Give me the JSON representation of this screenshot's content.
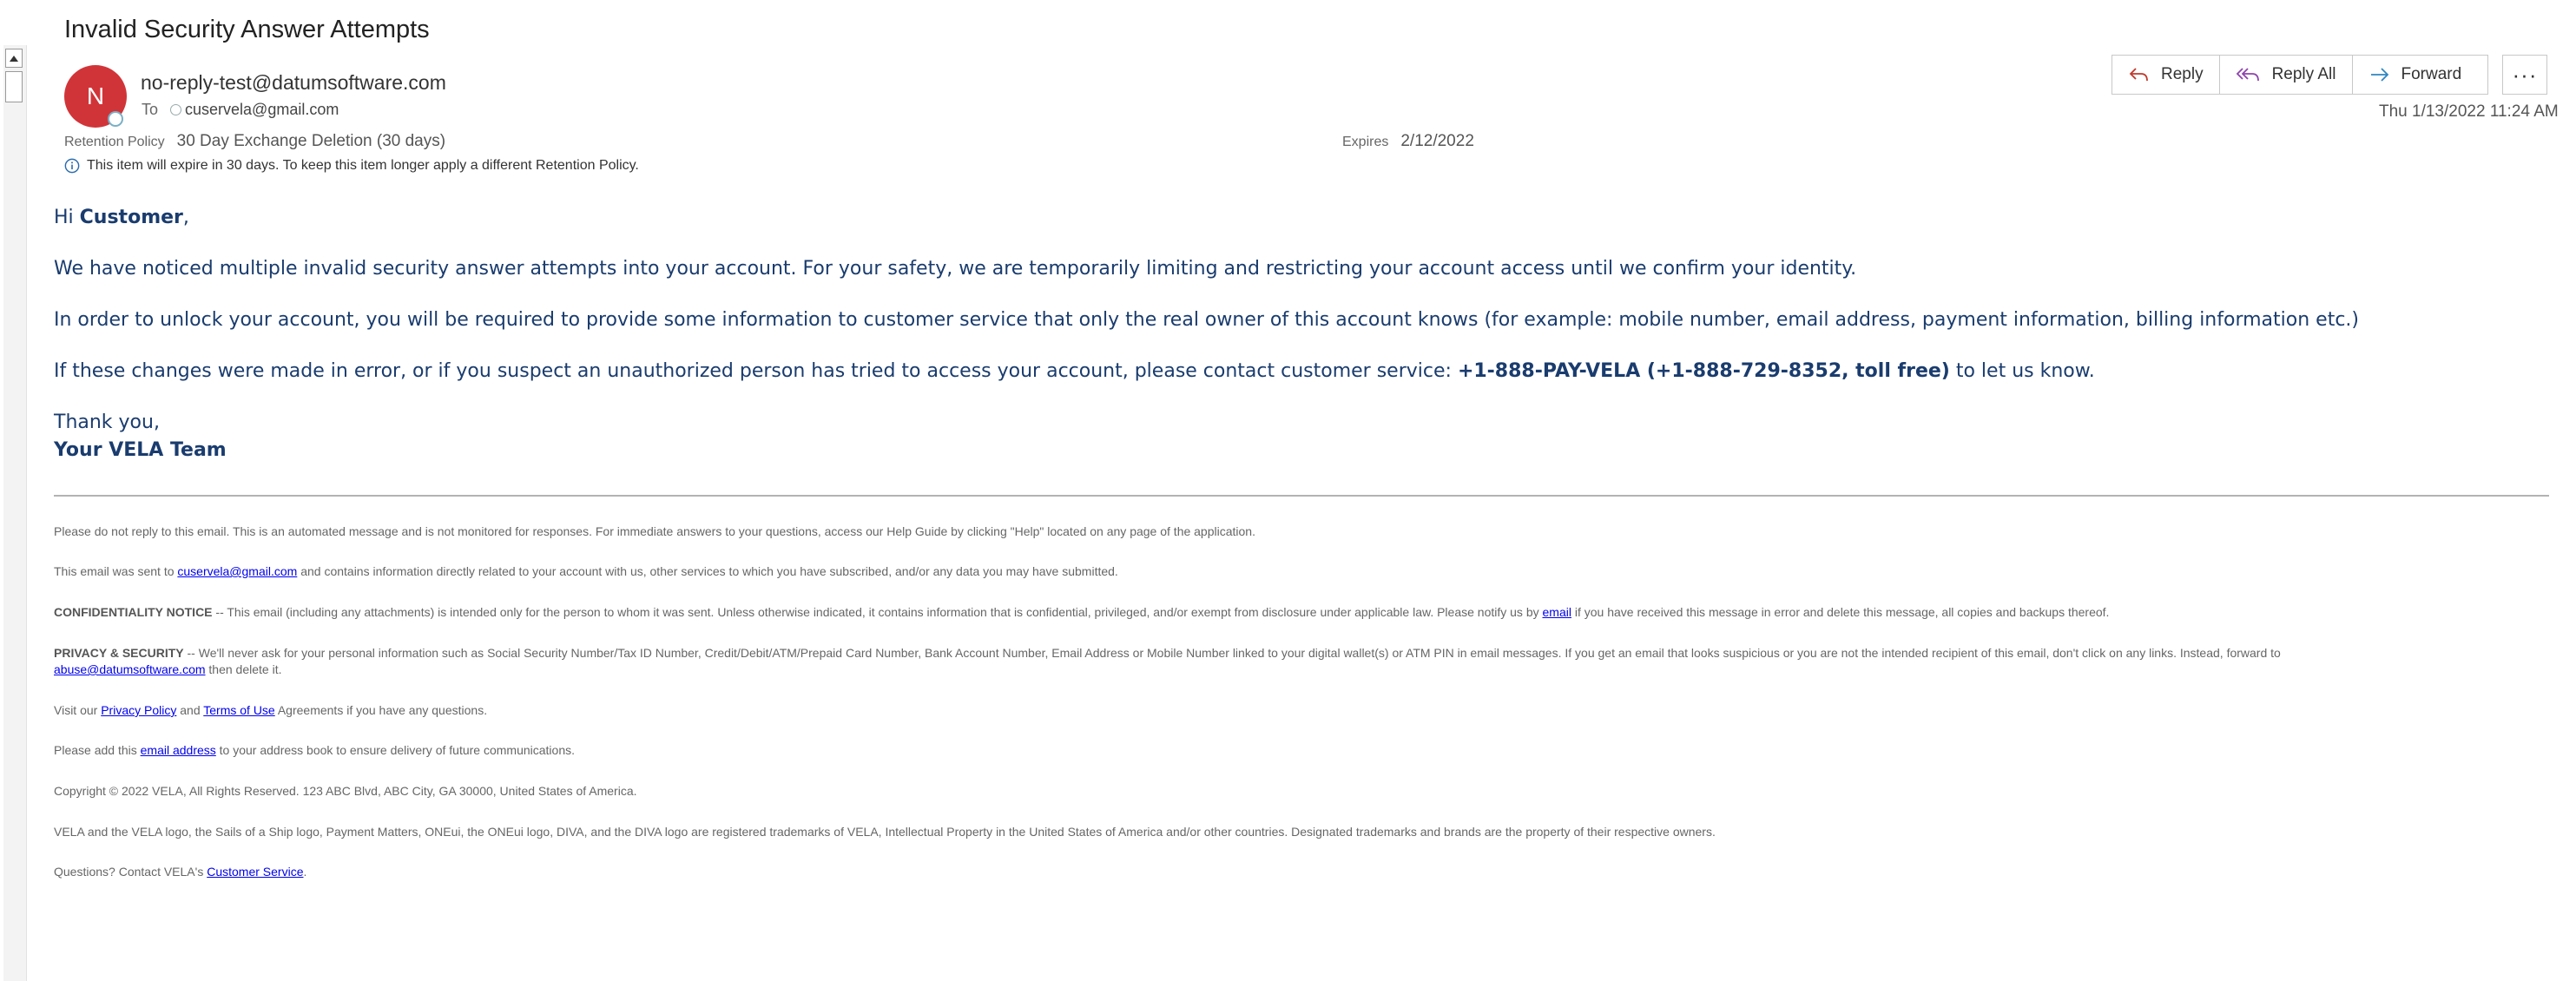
{
  "message": {
    "subject": "Invalid Security Answer Attempts",
    "avatar_initial": "N",
    "sender": "no-reply-test@datumsoftware.com",
    "to_label": "To",
    "recipient": "cuservela@gmail.com",
    "retention_label": "Retention Policy",
    "retention_value": "30 Day Exchange Deletion (30 days)",
    "expires_label": "Expires",
    "expires_value": "2/12/2022",
    "info_text": "This item will expire in 30 days. To keep this item longer apply a different Retention Policy.",
    "date": "Thu 1/13/2022 11:24 AM"
  },
  "toolbar": {
    "reply": "Reply",
    "reply_all": "Reply All",
    "forward": "Forward",
    "more": "···"
  },
  "body": {
    "greeting_hi": "Hi ",
    "greeting_name": "Customer",
    "greeting_comma": ",",
    "p1": "We have noticed multiple invalid security answer attempts into your account. For your safety, we are temporarily limiting and restricting your account access until we confirm your identity.",
    "p2": "In order to unlock your account, you will be required to provide some information to customer service that only the real owner of this account knows (for example: mobile number, email address, payment information, billing information etc.)",
    "p3_pre": "If these changes were made in error, or if you suspect an unauthorized person has tried to access your account, please contact customer service: ",
    "p3_phone": "+1-888-PAY-VELA (+1-888-729-8352, toll free)",
    "p3_post": " to let us know.",
    "thanks": "Thank you,",
    "team": "Your VELA Team"
  },
  "footer": {
    "f1": "Please do not reply to this email. This is an automated message and is not monitored for responses. For immediate answers to your questions, access our Help Guide by clicking \"Help\" located on any page of the application.",
    "f2_pre": "This email was sent to ",
    "f2_link": "cuservela@gmail.com",
    "f2_post": " and contains information directly related to your account with us, other services to which you have subscribed, and/or any data you may have submitted.",
    "f3_bold": "CONFIDENTIALITY NOTICE",
    "f3_pre": " -- This email (including any attachments) is intended only for the person to whom it was sent. Unless otherwise indicated, it contains information that is confidential, privileged, and/or exempt from disclosure under applicable law. Please notify us by ",
    "f3_link": "email",
    "f3_post": " if you have received this message in error and delete this message, all copies and backups thereof.",
    "f4_bold": "PRIVACY & SECURITY",
    "f4_pre": " -- We'll never ask for your personal information such as Social Security Number/Tax ID Number, Credit/Debit/ATM/Prepaid Card Number, Bank Account Number, Email Address or Mobile Number linked to your digital wallet(s) or ATM PIN in email messages. If you get an email that looks suspicious or you are not the intended recipient of this email, don't click on any links. Instead, forward to",
    "f4_link": "abuse@datumsoftware.com",
    "f4_post": " then delete it.",
    "f5_pre": "Visit our ",
    "f5_link1": "Privacy Policy",
    "f5_mid": " and ",
    "f5_link2": "Terms of Use",
    "f5_post": " Agreements if you have any questions.",
    "f6_pre": "Please add this ",
    "f6_link": "email address",
    "f6_post": " to your address book to ensure delivery of future communications.",
    "f7": "Copyright © 2022 VELA, All Rights Reserved. 123 ABC Blvd, ABC City, GA 30000, United States of America.",
    "f8": "VELA and the VELA logo, the Sails of a Ship logo, Payment Matters, ONEui, the ONEui logo, DIVA, and the DIVA logo are registered trademarks of VELA, Intellectual Property in the United States of America and/or other countries. Designated trademarks and brands are the property of their respective owners.",
    "f9_pre": "Questions? Contact VELA's ",
    "f9_link": "Customer Service",
    "f9_post": "."
  },
  "colors": {
    "avatar": "#d13438",
    "body_text": "#1a3c6e",
    "reply_icon": "#c0392b",
    "reply_all_icon": "#8e44ad",
    "forward_icon": "#2e86c1",
    "link": "#0000ee"
  },
  "icons": {
    "reply": "reply-arrow-icon",
    "reply_all": "reply-all-arrow-icon",
    "forward": "forward-arrow-icon",
    "more": "ellipsis-icon",
    "info": "info-circle-icon"
  }
}
